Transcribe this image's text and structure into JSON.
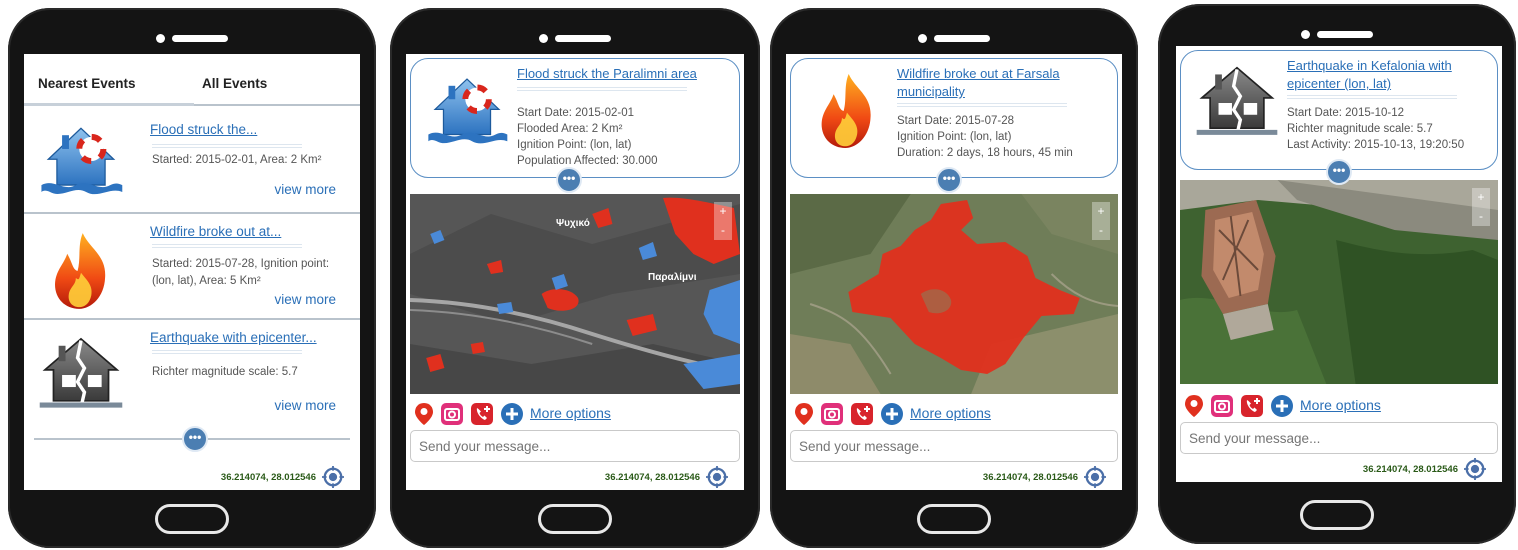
{
  "colors": {
    "accent": "#2a6fb7",
    "button": "#4b7eb2",
    "flood": "#4a8ad8",
    "fire": "#e0301e",
    "coords": "#2a5a18"
  },
  "coords": "36.214074, 28.012546",
  "list_screen": {
    "tabs": {
      "nearest": "Nearest Events",
      "all": "All Events"
    },
    "events": [
      {
        "icon": "flood-house-icon",
        "title": "Flood struck the...",
        "desc": "Started: 2015-02-01, Area: 2 Km²",
        "view_more": "view more"
      },
      {
        "icon": "wildfire-icon",
        "title": "Wildfire broke out at...",
        "desc": "Started: 2015-07-28, Ignition point: (lon, lat), Area: 5 Km²",
        "view_more": "view more"
      },
      {
        "icon": "earthquake-house-icon",
        "title": "Earthquake with epicenter...",
        "desc": "Richter magnitude scale: 5.7",
        "view_more": "view more"
      }
    ],
    "more_icon": "•••"
  },
  "details": [
    {
      "icon": "flood-house-icon",
      "title": "Flood struck the Paralimni area",
      "lines": [
        "Start Date: 2015-02-01",
        "Flooded Area: 2 Km²",
        "Ignition Point: (lon, lat)",
        "Population Affected: 30.000"
      ],
      "map_labels": [
        "Ψυχικό",
        "Παραλίμνι"
      ],
      "more_options": "More options",
      "message_placeholder": "Send your message..."
    },
    {
      "icon": "wildfire-icon",
      "title": "Wildfire broke out at Farsala municipality",
      "lines": [
        "Start Date: 2015-07-28",
        "Ignition Point: (lon, lat)",
        "Duration: 2 days, 18 hours, 45 min"
      ],
      "more_options": "More options",
      "message_placeholder": "Send your message..."
    },
    {
      "icon": "earthquake-house-icon",
      "title": "Earthquake in Kefalonia with epicenter (lon, lat)",
      "lines": [
        "Start Date: 2015-10-12",
        "Richter magnitude scale: 5.7",
        "Last Activity: 2015-10-13, 19:20:50"
      ],
      "more_options": "More options",
      "message_placeholder": "Send your message..."
    }
  ],
  "zoom": {
    "plus": "+",
    "minus": "-"
  }
}
